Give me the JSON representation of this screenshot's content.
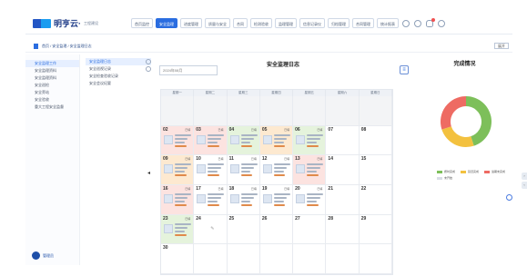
{
  "header": {
    "logo_text": "明亨云·",
    "logo_sub": "工程建设",
    "tabs": [
      {
        "label": "首页监控",
        "active": false
      },
      {
        "label": "安全监理",
        "active": true
      },
      {
        "label": "进度管理",
        "active": false
      },
      {
        "label": "质量与安全",
        "active": false
      },
      {
        "label": "合同",
        "active": false
      },
      {
        "label": "检测验收",
        "active": false
      },
      {
        "label": "监理管理",
        "active": false
      },
      {
        "label": "信息记录仪",
        "active": false
      },
      {
        "label": "归档管理",
        "active": false
      },
      {
        "label": "合同管理",
        "active": false
      },
      {
        "label": "统计报表",
        "active": false
      }
    ]
  },
  "breadcrumb": "首页 / 安全监理 / 安全监理日志",
  "subbar_right": "展开",
  "sidebar": {
    "items": [
      {
        "label": "安全监理工作",
        "active": true
      },
      {
        "label": "安全监理资料",
        "active": false
      },
      {
        "label": "安全监理资料",
        "active": false
      },
      {
        "label": "安全巡检",
        "active": false
      },
      {
        "label": "安全旁站",
        "active": false
      },
      {
        "label": "安全验收",
        "active": false
      },
      {
        "label": "重大工程安全监督",
        "active": false
      }
    ],
    "user_label": "管理员"
  },
  "subnav": [
    {
      "label": "安全监理日志",
      "active": true
    },
    {
      "label": "安全巡视记录",
      "active": false
    },
    {
      "label": "安全检查验收记录",
      "active": false
    },
    {
      "label": "安全会议纪要",
      "active": false
    }
  ],
  "main": {
    "title": "安全监理日志",
    "date_value": "2024年08月",
    "weekdays": [
      "星期一",
      "星期二",
      "星期三",
      "星期四",
      "星期五",
      "星期六",
      "星期日"
    ],
    "weeks": [
      [
        {
          "n": "",
          "c": "gray"
        },
        {
          "n": "",
          "c": "gray"
        },
        {
          "n": "",
          "c": "gray"
        },
        {
          "n": "",
          "c": "gray"
        },
        {
          "n": "",
          "c": "gray"
        },
        {
          "n": "",
          "c": "gray"
        },
        {
          "n": "",
          "c": "gray"
        }
      ],
      [
        {
          "n": "02",
          "c": "red",
          "e": true
        },
        {
          "n": "03",
          "c": "red",
          "e": true
        },
        {
          "n": "04",
          "c": "green",
          "e": true
        },
        {
          "n": "05",
          "c": "orange",
          "e": true
        },
        {
          "n": "06",
          "c": "green",
          "e": true
        },
        {
          "n": "07",
          "c": "white"
        },
        {
          "n": "08",
          "c": "white"
        }
      ],
      [
        {
          "n": "09",
          "c": "orange",
          "e": true
        },
        {
          "n": "10",
          "c": "white",
          "e": true
        },
        {
          "n": "11",
          "c": "white",
          "e": true
        },
        {
          "n": "12",
          "c": "white",
          "e": true
        },
        {
          "n": "13",
          "c": "red",
          "e": true
        },
        {
          "n": "14",
          "c": "white"
        },
        {
          "n": "15",
          "c": "white"
        }
      ],
      [
        {
          "n": "16",
          "c": "red",
          "e": true
        },
        {
          "n": "17",
          "c": "white",
          "e": true
        },
        {
          "n": "18",
          "c": "white",
          "e": true
        },
        {
          "n": "19",
          "c": "white",
          "e": true
        },
        {
          "n": "20",
          "c": "white",
          "e": true
        },
        {
          "n": "21",
          "c": "white"
        },
        {
          "n": "22",
          "c": "white"
        }
      ],
      [
        {
          "n": "23",
          "c": "green",
          "e": true
        },
        {
          "n": "24",
          "c": "white",
          "pen": true
        },
        {
          "n": "25",
          "c": "white"
        },
        {
          "n": "26",
          "c": "white"
        },
        {
          "n": "27",
          "c": "white"
        },
        {
          "n": "28",
          "c": "white"
        },
        {
          "n": "29",
          "c": "white"
        }
      ],
      [
        {
          "n": "30",
          "c": "white"
        },
        {
          "n": "",
          "c": "white"
        },
        {
          "n": "",
          "c": "white"
        },
        {
          "n": "",
          "c": "white"
        },
        {
          "n": "",
          "c": "white"
        },
        {
          "n": "",
          "c": "white"
        },
        {
          "n": "",
          "c": "white"
        }
      ]
    ],
    "entry_tag": "已填"
  },
  "completion": {
    "title": "完成情况",
    "slices": [
      {
        "name": "按时完成",
        "value": 45,
        "color": "#7dbf5a"
      },
      {
        "name": "延迟完成",
        "value": 25,
        "color": "#f3c13f"
      },
      {
        "name": "逾期未完成",
        "value": 30,
        "color": "#ee6b63"
      }
    ],
    "legend_extra": "未开始"
  },
  "icons": [
    "search-icon",
    "settings-icon",
    "bell-icon",
    "logout-icon",
    "document-icon",
    "calendar-icon",
    "help-icon"
  ]
}
